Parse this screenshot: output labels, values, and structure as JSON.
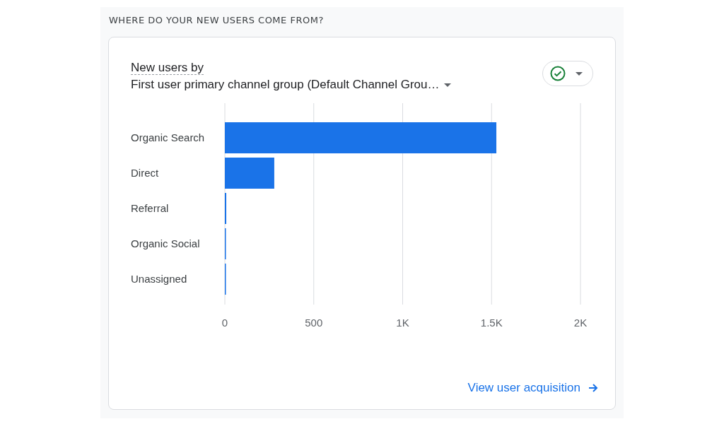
{
  "section_title": "WHERE DO YOUR NEW USERS COME FROM?",
  "card": {
    "metric_label": "New users by",
    "dimension_selector": "First user primary channel group (Default Channel Grou…",
    "chart_data": {
      "type": "bar",
      "orientation": "horizontal",
      "categories": [
        "Organic Search",
        "Direct",
        "Referral",
        "Organic Social",
        "Unassigned"
      ],
      "series": [
        {
          "color": "#1a73e8",
          "values": [
            1527,
            278,
            8,
            2,
            2
          ]
        }
      ],
      "grid": true,
      "xlim": [
        0,
        2000
      ],
      "xticks": [
        {
          "value": 0,
          "label": "0"
        },
        {
          "value": 500,
          "label": "500"
        },
        {
          "value": 1000,
          "label": "1K"
        },
        {
          "value": 1500,
          "label": "1.5K"
        },
        {
          "value": 2000,
          "label": "2K"
        }
      ]
    },
    "link": "View user acquisition"
  }
}
